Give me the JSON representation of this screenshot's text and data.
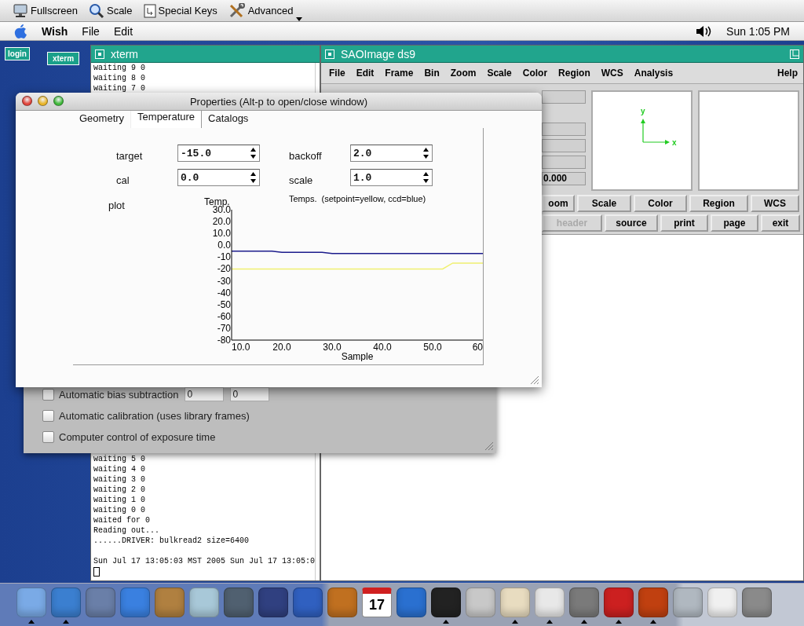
{
  "toolbar": [
    {
      "label": "Fullscreen",
      "kind": "fullscreen"
    },
    {
      "label": "Scale",
      "kind": "scale"
    },
    {
      "label": "Special Keys",
      "kind": "keys"
    },
    {
      "label": "Advanced",
      "kind": "advanced"
    }
  ],
  "menubar": {
    "app": "Wish",
    "menus": [
      "File",
      "Edit"
    ],
    "clock": "Sun 1:05 PM"
  },
  "desktop_icons": [
    {
      "label": "login"
    },
    {
      "label": "xterm"
    }
  ],
  "xterm": {
    "title": "xterm",
    "top_lines": [
      "waiting 9 0",
      "waiting 8 0",
      "waiting 7 0"
    ],
    "log_lines": [
      "waiting 5 0",
      "waiting 4 0",
      "waiting 3 0",
      "waiting 2 0",
      "waiting 1 0",
      "waiting 0 0",
      "waited for 0",
      "Reading out...",
      "......DRIVER: bulkread2 size=6400"
    ],
    "date_line": "Sun Jul 17 13:05:03 MST 2005 Sun Jul 17 13:05:0"
  },
  "ds9": {
    "title": "SAOImage ds9",
    "menus": [
      "File",
      "Edit",
      "Frame",
      "Bin",
      "Zoom",
      "Scale",
      "Color",
      "Region",
      "WCS",
      "Analysis"
    ],
    "help": "Help",
    "info_value": "0.000",
    "compass": {
      "y_label": "y",
      "x_label": "x"
    },
    "button_rows": [
      [
        {
          "label": "oom",
          "disabled": false
        },
        {
          "label": "Scale",
          "disabled": false
        },
        {
          "label": "Color",
          "disabled": false
        },
        {
          "label": "Region",
          "disabled": false
        },
        {
          "label": "WCS",
          "disabled": false
        }
      ],
      [
        {
          "label": "header",
          "disabled": true
        },
        {
          "label": "source",
          "disabled": false
        },
        {
          "label": "print",
          "disabled": false
        },
        {
          "label": "page",
          "disabled": false
        },
        {
          "label": "exit",
          "disabled": false
        }
      ]
    ]
  },
  "options": [
    {
      "label": "Automatic bias subtraction",
      "checked": false,
      "fields": [
        "0",
        "0"
      ]
    },
    {
      "label": "Automatic calibration (uses library frames)",
      "checked": false
    },
    {
      "label": "Computer control of exposure time",
      "checked": false
    }
  ],
  "properties": {
    "title": "Properties (Alt-p to open/close window)",
    "tabs": [
      {
        "label": "Geometry",
        "selected": false
      },
      {
        "label": "Temperature",
        "selected": true
      },
      {
        "label": "Catalogs",
        "selected": false
      }
    ],
    "fields": [
      {
        "label": "target",
        "value": "-15.0"
      },
      {
        "label": "backoff",
        "value": "2.0"
      },
      {
        "label": "cal",
        "value": "0.0"
      },
      {
        "label": "scale",
        "value": "1.0"
      }
    ],
    "plot_label": "plot",
    "chart_data": {
      "type": "line",
      "title": "Temps.  (setpoint=yellow, ccd=blue)",
      "xlabel": "Sample",
      "ylabel": "Temp.",
      "x": [
        10,
        12,
        14,
        16,
        18,
        20,
        22,
        24,
        26,
        28,
        30,
        32,
        34,
        36,
        38,
        40,
        42,
        44,
        46,
        48,
        50,
        52,
        54,
        56,
        58,
        60
      ],
      "series": [
        {
          "color": "#1c1c8c",
          "values": [
            -5,
            -5,
            -5,
            -5,
            -5,
            -6,
            -6,
            -6,
            -6,
            -6,
            -7,
            -7,
            -7,
            -7,
            -7,
            -7,
            -7,
            -7,
            -7,
            -7,
            -7,
            -7,
            -7,
            -7,
            -7,
            -7
          ]
        },
        {
          "color": "#f0f070",
          "values": [
            -20,
            -20,
            -20,
            -20,
            -20,
            -20,
            -20,
            -20,
            -20,
            -20,
            -20,
            -20,
            -20,
            -20,
            -20,
            -20,
            -20,
            -20,
            -20,
            -20,
            -20,
            -20,
            -15,
            -15,
            -15,
            -15
          ]
        }
      ],
      "xlim": [
        10,
        60
      ],
      "ylim": [
        -80,
        30
      ],
      "xticks": [
        {
          "value": 10,
          "label": "10.0"
        },
        {
          "value": 20,
          "label": "20.0"
        },
        {
          "value": 30,
          "label": "30.0"
        },
        {
          "value": 40,
          "label": "40.0"
        },
        {
          "value": 50,
          "label": "50.0"
        },
        {
          "value": 60,
          "label": "60"
        }
      ],
      "yticks": [
        {
          "value": 30,
          "label": "30.0"
        },
        {
          "value": 20,
          "label": "20.0"
        },
        {
          "value": 10,
          "label": "10.0"
        },
        {
          "value": 0,
          "label": "0.0"
        },
        {
          "value": -10,
          "label": "-10"
        },
        {
          "value": -20,
          "label": "-20"
        },
        {
          "value": -30,
          "label": "-30"
        },
        {
          "value": -40,
          "label": "-40"
        },
        {
          "value": -50,
          "label": "-50"
        },
        {
          "value": -60,
          "label": "-60"
        },
        {
          "value": -70,
          "label": "-70"
        },
        {
          "value": -80,
          "label": "-80"
        }
      ]
    }
  },
  "dock": [
    {
      "kind": "app",
      "running": true
    },
    {
      "kind": "app",
      "running": true
    },
    {
      "kind": "app",
      "running": false
    },
    {
      "kind": "app",
      "running": false
    },
    {
      "kind": "app",
      "running": false
    },
    {
      "kind": "app",
      "running": false
    },
    {
      "kind": "app",
      "running": false
    },
    {
      "kind": "app",
      "running": false
    },
    {
      "kind": "app",
      "running": false
    },
    {
      "kind": "app",
      "running": false
    },
    {
      "kind": "calendar",
      "label": "17",
      "running": false
    },
    {
      "kind": "app",
      "running": false
    },
    {
      "kind": "app",
      "running": true
    },
    {
      "kind": "app",
      "running": false
    },
    {
      "kind": "app",
      "running": true
    },
    {
      "kind": "app",
      "running": true
    },
    {
      "kind": "app",
      "running": true
    },
    {
      "kind": "app",
      "running": true
    },
    {
      "kind": "app",
      "running": true
    },
    {
      "kind": "app",
      "running": false
    },
    {
      "kind": "app",
      "running": false
    },
    {
      "kind": "app",
      "running": false
    }
  ]
}
